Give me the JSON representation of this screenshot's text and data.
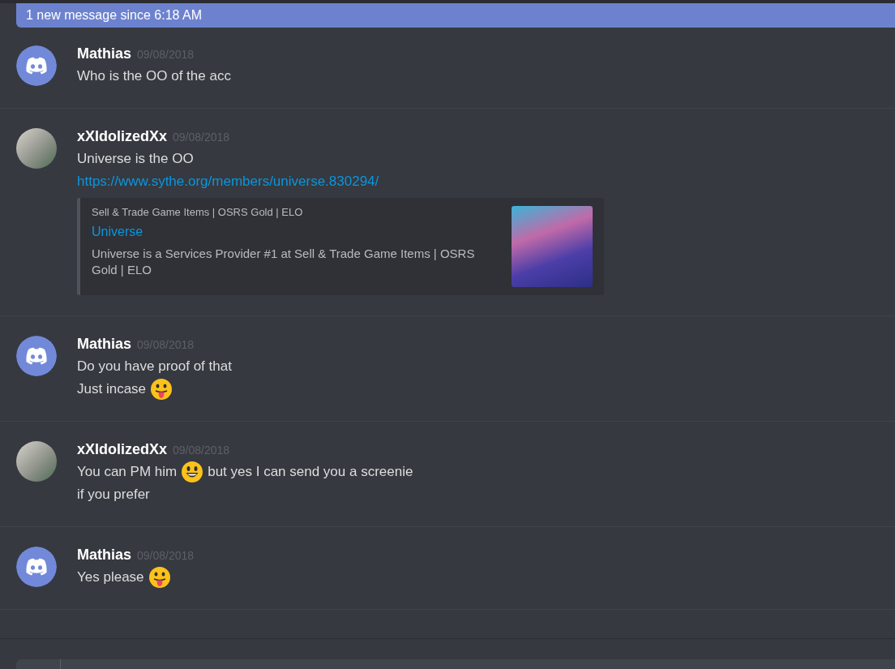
{
  "new_messages_bar": {
    "text": "1 new message since 6:18 AM"
  },
  "messages": [
    {
      "author": "Mathias",
      "avatar": {
        "kind": "discord"
      },
      "timestamp": "09/08/2018",
      "lines": [
        [
          {
            "kind": "text",
            "text": "Who is the OO of the acc"
          }
        ]
      ]
    },
    {
      "author": "xXIdolizedXx",
      "avatar": {
        "kind": "photo"
      },
      "timestamp": "09/08/2018",
      "lines": [
        [
          {
            "kind": "text",
            "text": "Universe is the OO"
          }
        ],
        [
          {
            "kind": "link",
            "text": "https://www.sythe.org/members/universe.830294/"
          }
        ]
      ],
      "embed": {
        "provider": "Sell & Trade Game Items | OSRS Gold | ELO",
        "title": "Universe",
        "description": "Universe is a Services Provider #1 at Sell & Trade Game Items | OSRS Gold | ELO"
      }
    },
    {
      "author": "Mathias",
      "avatar": {
        "kind": "discord"
      },
      "timestamp": "09/08/2018",
      "lines": [
        [
          {
            "kind": "text",
            "text": "Do you have proof of that"
          }
        ],
        [
          {
            "kind": "text",
            "text": "Just incase"
          },
          {
            "kind": "tongue"
          }
        ]
      ]
    },
    {
      "author": "xXIdolizedXx",
      "avatar": {
        "kind": "photo"
      },
      "timestamp": "09/08/2018",
      "lines": [
        [
          {
            "kind": "text",
            "text": "You can PM him"
          },
          {
            "kind": "smile"
          },
          {
            "kind": "text",
            "text": "but yes I can send you a screenie"
          }
        ],
        [
          {
            "kind": "text",
            "text": "if you prefer"
          }
        ]
      ]
    },
    {
      "author": "Mathias",
      "avatar": {
        "kind": "discord"
      },
      "timestamp": "09/08/2018",
      "lines": [
        [
          {
            "kind": "text",
            "text": "Yes please"
          },
          {
            "kind": "tongue"
          }
        ]
      ]
    }
  ]
}
